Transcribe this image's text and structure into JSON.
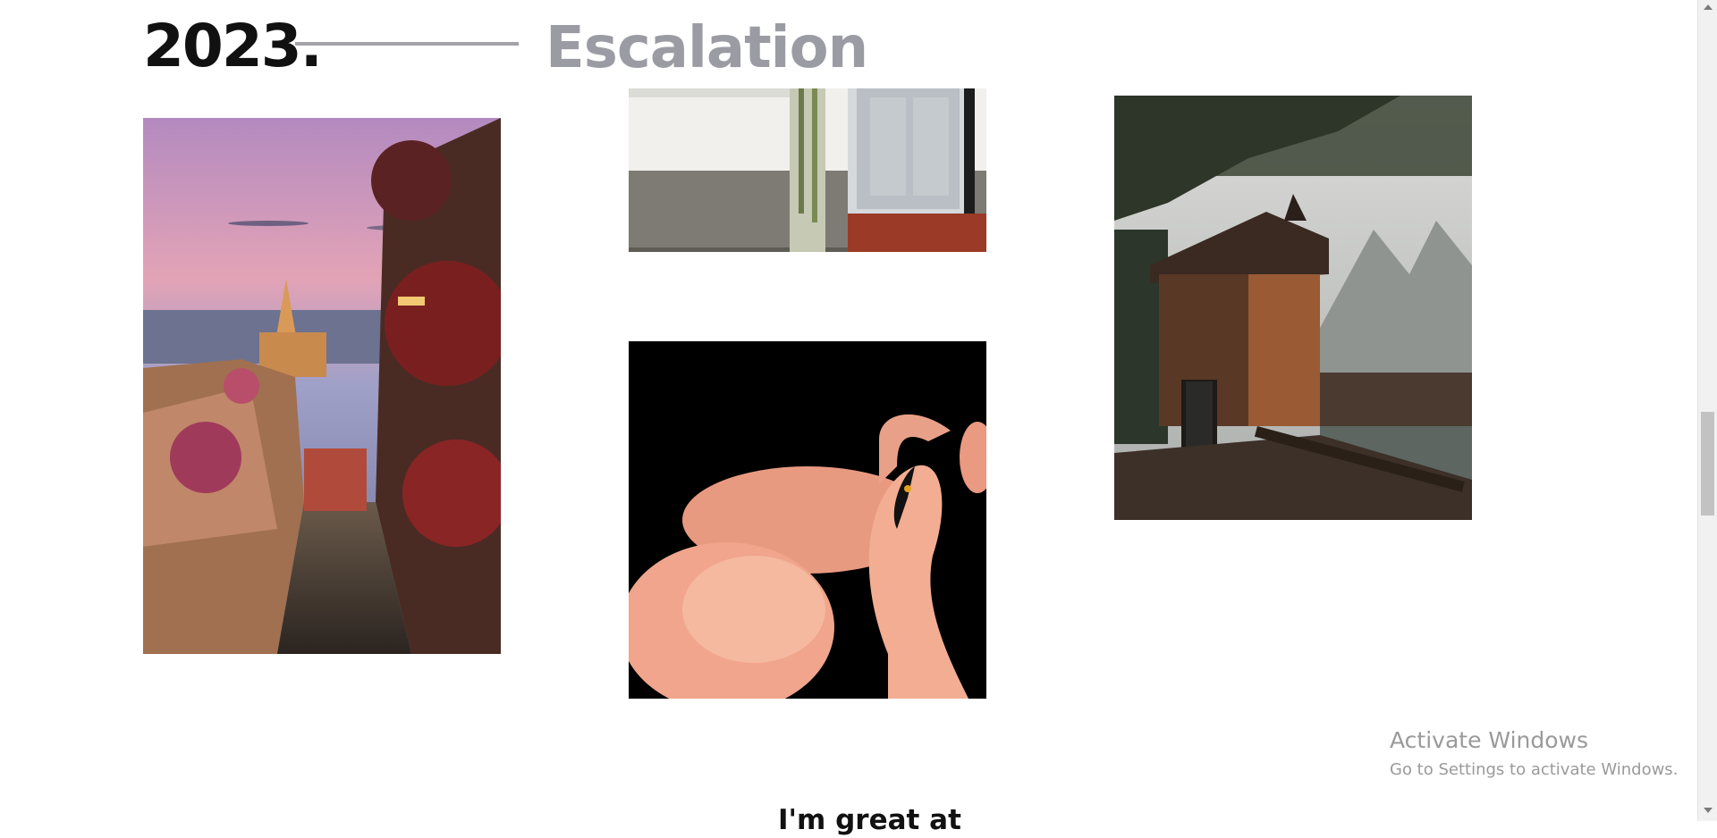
{
  "section": {
    "year": "2023.",
    "title": "Escalation"
  },
  "gallery": {
    "images": [
      {
        "name": "street-at-dusk-photo",
        "subject": "cobblestone street with cathedral at dusk"
      },
      {
        "name": "white-wall-door-photo",
        "subject": "white brick wall with grey door"
      },
      {
        "name": "flamingos-photo",
        "subject": "pink flamingos on black background"
      },
      {
        "name": "boathouse-photo",
        "subject": "wooden boathouse by a misty lake"
      }
    ]
  },
  "watermark": {
    "title": "Activate Windows",
    "subtitle": "Go to Settings to activate Windows."
  },
  "next_section": {
    "heading": "I'm great at"
  },
  "colors": {
    "heading": "#111111",
    "accent_gray": "#9b9ba4",
    "rule": "#a3a3a8"
  }
}
